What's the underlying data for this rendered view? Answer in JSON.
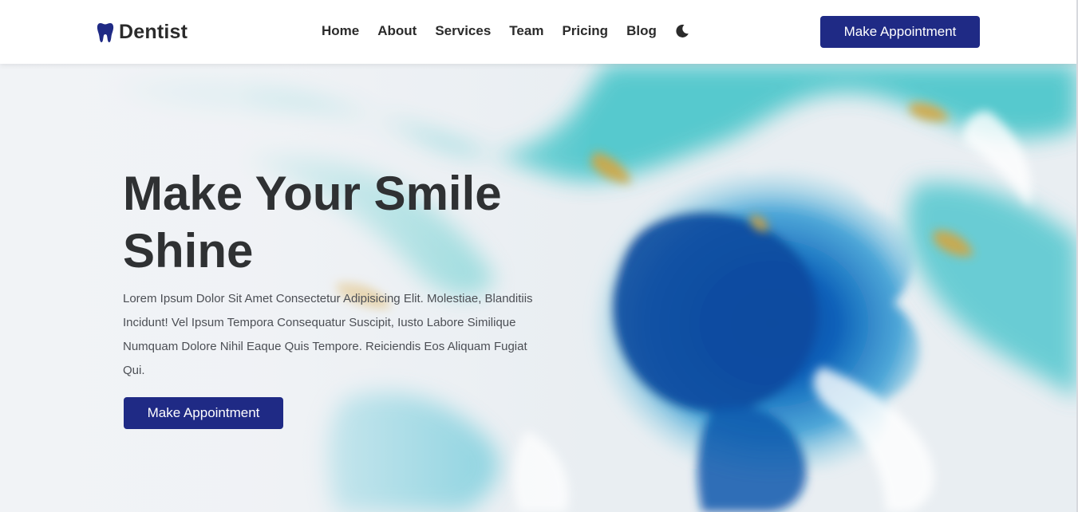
{
  "brand": {
    "name": "Dentist",
    "icon": "tooth-icon"
  },
  "nav": {
    "items": [
      {
        "label": "Home"
      },
      {
        "label": "About"
      },
      {
        "label": "Services"
      },
      {
        "label": "Team"
      },
      {
        "label": "Pricing"
      },
      {
        "label": "Blog"
      }
    ],
    "theme_icon": "moon-icon"
  },
  "header": {
    "cta_label": "Make Appointment"
  },
  "hero": {
    "title": "Make Your Smile Shine",
    "text": "Lorem Ipsum Dolor Sit Amet Consectetur Adipisicing Elit. Molestiae, Blanditiis Incidunt! Vel Ipsum Tempora Consequatur Suscipit, Iusto Labore Similique Numquam Dolore Nihil Eaque Quis Tempore. Reiciendis Eos Aliquam Fugiat Qui.",
    "cta_label": "Make Appointment"
  },
  "colors": {
    "brand": "#1f2a85",
    "heading": "#2f3133",
    "body_text": "#4c4f55"
  }
}
